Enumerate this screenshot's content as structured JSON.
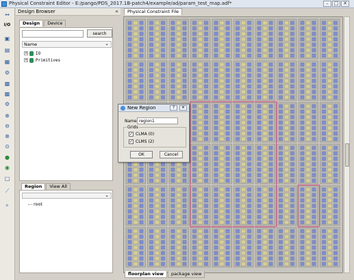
{
  "window": {
    "title": "Physical Constraint Editor - E:/pango/PDS_2017.1B-patch4/example/ad/param_test_map.adf*",
    "minimize_glyph": "–",
    "maximize_glyph": "□",
    "close_glyph": "✕"
  },
  "toolbar": {
    "buttons": [
      {
        "icon": "arrows-icon",
        "glyph": "↔"
      },
      {
        "icon": "io-icon",
        "glyph": "I/O"
      },
      {
        "icon": "package-icon",
        "glyph": "▣"
      },
      {
        "icon": "save-icon",
        "glyph": "▤"
      },
      {
        "icon": "floorplan-icon",
        "glyph": "▦"
      },
      {
        "icon": "gear-icon",
        "glyph": "⚙"
      },
      {
        "icon": "disk-icon",
        "glyph": "▩"
      },
      {
        "icon": "disk-alt-icon",
        "glyph": "▩"
      },
      {
        "icon": "settings-icon",
        "glyph": "⚙"
      },
      {
        "icon": "zoom-in-icon",
        "glyph": "⊕"
      },
      {
        "icon": "zoom-out-icon",
        "glyph": "⊖"
      },
      {
        "icon": "zoom-fit-icon",
        "glyph": "⊗"
      },
      {
        "icon": "zoom-area-icon",
        "glyph": "⊙"
      },
      {
        "icon": "green-circle-icon",
        "glyph": "●"
      },
      {
        "icon": "green-ring-icon",
        "glyph": "◉"
      },
      {
        "icon": "rectangle-icon",
        "glyph": "□"
      },
      {
        "icon": "line-icon",
        "glyph": "⟋"
      },
      {
        "icon": "search-icon",
        "glyph": "⌕"
      }
    ]
  },
  "design_browser": {
    "title": "Design Browser",
    "dock_glyph": "«",
    "tabs": [
      "Design",
      "Device"
    ],
    "search_value": "",
    "search_button": "search",
    "column_header": "Name",
    "tree": [
      {
        "expander": "+",
        "label": "IO"
      },
      {
        "expander": "+",
        "label": "Primitives"
      }
    ],
    "region_tabs": [
      "Region",
      "View All"
    ],
    "region_items": [
      "root"
    ]
  },
  "main": {
    "document_tab": "Physical Constraint File",
    "bottom_tabs": [
      "floorplan view",
      "package view"
    ]
  },
  "dialog": {
    "title": "New Region",
    "help_glyph": "?",
    "close_glyph": "✕",
    "name_label": "Name:",
    "name_value": "region1",
    "grids_label": "Grids",
    "checkboxes": [
      {
        "label": "CLMA (0)",
        "checked": true
      },
      {
        "label": "CLMS (2)",
        "checked": true
      }
    ],
    "check_glyph": "✓",
    "ok_label": "OK",
    "cancel_label": "Cancel"
  },
  "colors": {
    "selection_outline": "#d8508a",
    "cell_fill": "#b9b7b0",
    "slot_blue": "#7f8fd0",
    "slot_yellow": "#d8d09a"
  }
}
